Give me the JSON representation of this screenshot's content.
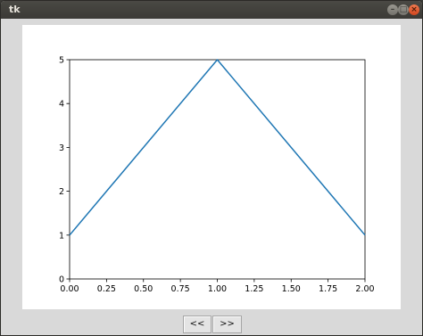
{
  "window": {
    "title": "tk",
    "minimize_icon": "minimize-icon",
    "maximize_icon": "maximize-icon",
    "close_icon": "close-icon",
    "close_color": "#e05a2c"
  },
  "navigation": {
    "prev_label": "<<",
    "next_label": ">>"
  },
  "chart_data": {
    "type": "line",
    "x": [
      0.0,
      1.0,
      2.0
    ],
    "series": [
      {
        "values": [
          1,
          5,
          1
        ],
        "color": "#1f77b4"
      }
    ],
    "xlim": [
      0.0,
      2.0
    ],
    "ylim": [
      0,
      5
    ],
    "xticks": [
      0.0,
      0.25,
      0.5,
      0.75,
      1.0,
      1.25,
      1.5,
      1.75,
      2.0
    ],
    "xtick_labels": [
      "0.00",
      "0.25",
      "0.50",
      "0.75",
      "1.00",
      "1.25",
      "1.50",
      "1.75",
      "2.00"
    ],
    "yticks": [
      0,
      1,
      2,
      3,
      4,
      5
    ],
    "ytick_labels": [
      "0",
      "1",
      "2",
      "3",
      "4",
      "5"
    ],
    "grid": false,
    "title": "",
    "xlabel": "",
    "ylabel": ""
  }
}
